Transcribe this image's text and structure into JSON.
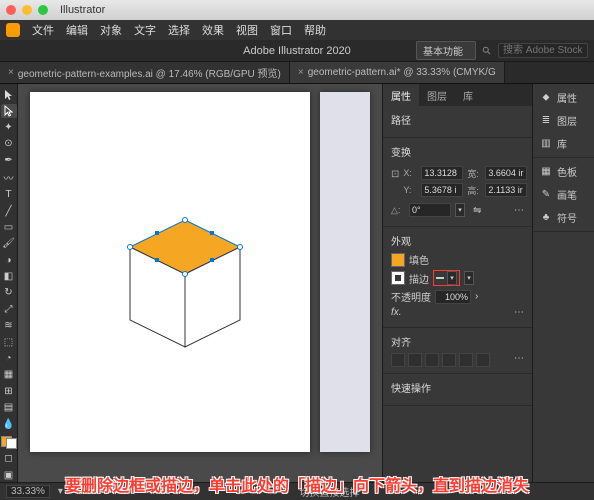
{
  "mac": {
    "app": "Illustrator",
    "menus": [
      "文件",
      "编辑",
      "对象",
      "文字",
      "选择",
      "效果",
      "视图",
      "窗口",
      "帮助"
    ]
  },
  "app_title": "Adobe Illustrator 2020",
  "workspace_selector": "基本功能",
  "search": {
    "placeholder": "搜索 Adobe Stock"
  },
  "tabs": [
    {
      "label": "geometric-pattern-examples.ai @ 17.46% (RGB/GPU 预览)",
      "active": false
    },
    {
      "label": "geometric-pattern.ai* @ 33.33% (CMYK/G",
      "active": true
    }
  ],
  "panel_tabs": [
    "属性",
    "图层",
    "库"
  ],
  "panel_active_tab": "属性",
  "selection_type": "路径",
  "transform": {
    "heading": "变换",
    "x_label": "X:",
    "x": "13.3128",
    "w_label": "宽:",
    "w": "3.6604 ir",
    "y_label": "Y:",
    "y": "5.3678 i",
    "h_label": "高:",
    "h": "2.1133 ir",
    "angle_label": "△:",
    "angle": "0°"
  },
  "appearance": {
    "heading": "外观",
    "fill_label": "填色",
    "stroke_label": "描边",
    "opacity_label": "不透明度",
    "opacity": "100%",
    "fx_label": "fx."
  },
  "align": {
    "heading": "对齐"
  },
  "quick": {
    "heading": "快速操作"
  },
  "dock": {
    "groups": [
      [
        "属性",
        "图层",
        "库"
      ],
      [
        "色板",
        "画笔",
        "符号"
      ]
    ]
  },
  "status": {
    "zoom": "33.33%",
    "hint": "切换直接选择"
  },
  "instruction": "要删除边框或描边，单击此处的「描边」向下箭头，直到描边消失"
}
